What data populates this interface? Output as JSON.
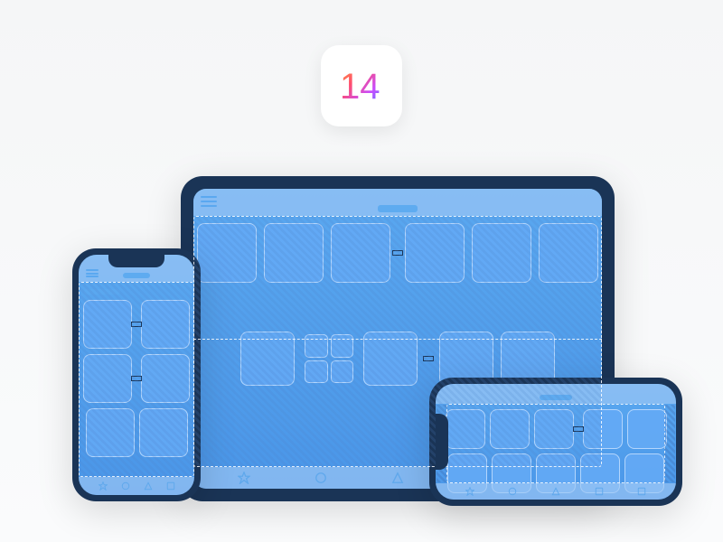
{
  "badge": {
    "label": "14"
  },
  "colors": {
    "device_frame": "#1a3456",
    "screen_bg": "#4a96e8",
    "tile_fill": "#64aaf5",
    "tile_border": "#c8e1ff",
    "guide": "#ffffff"
  },
  "tab_icons": [
    "star-icon",
    "circle-icon",
    "triangle-icon",
    "square-icon",
    "square-icon"
  ],
  "devices": {
    "tablet": {
      "rows": [
        6,
        5
      ]
    },
    "phone_portrait": {
      "rows": [
        2,
        2,
        2
      ]
    },
    "phone_landscape": {
      "rows": [
        5,
        5
      ]
    }
  }
}
